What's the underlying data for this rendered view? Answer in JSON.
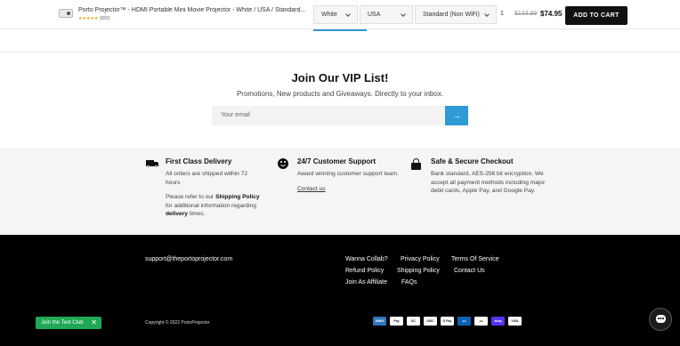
{
  "sticky_bar": {
    "product_title": "Porto Projector™ - HDMI Portable Mini Movie Projector - White / USA / Standard...",
    "stars": "★★★★★",
    "review_count": "(650)",
    "color_select": "White",
    "region_select": "USA",
    "model_select": "Standard (Non WiFi)",
    "quantity": "1",
    "old_price": "$133.99",
    "new_price": "$74.95",
    "add_to_cart": "ADD TO CART"
  },
  "vip": {
    "title": "Join Our VIP List!",
    "subtitle": "Promotions, New products and Giveaways. Directly to your inbox.",
    "email_placeholder": "Your email",
    "submit_icon": "→"
  },
  "features": [
    {
      "icon": "truck-icon",
      "title": "First Class Delivery",
      "text1": "All orders are shipped within 72 hours",
      "text2_pre": "Please refer to our ",
      "text2_bold1": "Shipping Policy",
      "text2_mid": " for additional information regarding ",
      "text2_bold2": "delivery",
      "text2_post": " times."
    },
    {
      "icon": "smile-icon",
      "title": "24/7 Customer Support",
      "text1": "Award winning customer support team.",
      "link": "Contact us"
    },
    {
      "icon": "lock-icon",
      "title": "Safe & Secure Checkout",
      "text1": "Bank standard, AES-256 bit encryption. We accept all payment methods including major debit cards, Apple Pay, and Google Pay."
    }
  ],
  "footer": {
    "support_email": "support@theportoprojector.com",
    "links": [
      "Wanna Collab?",
      "Privacy Policy",
      "Terms Of Service",
      "Refund Policy",
      "Shipping Policy",
      "Contact Us",
      "Join As Affiliate",
      "FAQs"
    ],
    "copyright": "Copyright © 2022 PortoProjector",
    "payments": [
      {
        "name": "amex-icon",
        "label": "AMEX",
        "color": "#2e77bc"
      },
      {
        "name": "apple-pay-icon",
        "label": "Pay",
        "color": "#ffffff"
      },
      {
        "name": "diners-icon",
        "label": "DC",
        "color": "#ffffff"
      },
      {
        "name": "discover-icon",
        "label": "DISC",
        "color": "#ffffff"
      },
      {
        "name": "google-pay-icon",
        "label": "G Pay",
        "color": "#ffffff"
      },
      {
        "name": "maestro-icon",
        "label": "●●",
        "color": "#0c62b7"
      },
      {
        "name": "mastercard-icon",
        "label": "●●",
        "color": "#ffffff"
      },
      {
        "name": "shop-pay-icon",
        "label": "shop",
        "color": "#5a31f4"
      },
      {
        "name": "visa-icon",
        "label": "VISA",
        "color": "#ffffff"
      }
    ]
  },
  "widgets": {
    "text_club": "Join the Text Club",
    "text_club_close": "✕"
  }
}
